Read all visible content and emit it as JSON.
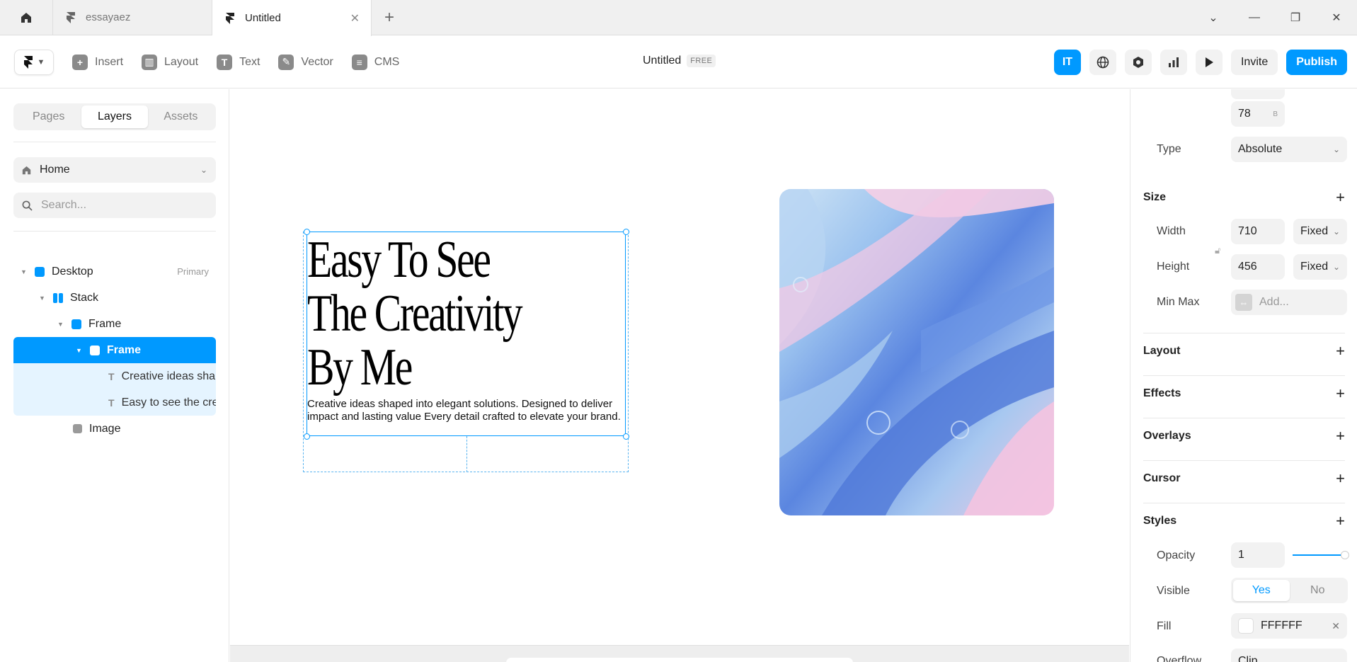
{
  "tabs": [
    {
      "label": "essayaez"
    },
    {
      "label": "Untitled"
    }
  ],
  "toolbar": {
    "tools": [
      {
        "label": "Insert",
        "icon": "plus-square-icon"
      },
      {
        "label": "Layout",
        "icon": "layout-icon"
      },
      {
        "label": "Text",
        "icon": "text-icon"
      },
      {
        "label": "Vector",
        "icon": "pen-icon"
      },
      {
        "label": "CMS",
        "icon": "database-icon"
      }
    ],
    "doc_title": "Untitled",
    "plan_badge": "FREE",
    "avatar_initials": "IT",
    "invite_label": "Invite",
    "publish_label": "Publish"
  },
  "left_panel": {
    "segments": [
      "Pages",
      "Layers",
      "Assets"
    ],
    "active_segment": "Layers",
    "page": "Home",
    "search_placeholder": "Search...",
    "layers": [
      {
        "label": "Desktop",
        "tag": "Primary"
      },
      {
        "label": "Stack"
      },
      {
        "label": "Frame"
      },
      {
        "label": "Frame"
      },
      {
        "label": "Creative ideas shaped into elegant solutions"
      },
      {
        "label": "Easy to see the creativity by me"
      },
      {
        "label": "Image"
      }
    ]
  },
  "canvas": {
    "headline_lines": [
      "Easy To See",
      "The Creativity",
      "By Me"
    ],
    "body": "Creative ideas shaped into elegant solutions. Designed to deliver impact and lasting value Every detail crafted to elevate your brand."
  },
  "right_panel": {
    "bottom_value": "78",
    "bottom_suffix": "B",
    "type_label": "Type",
    "type_value": "Absolute",
    "size_section": "Size",
    "width_label": "Width",
    "width_value": "710",
    "width_mode": "Fixed",
    "height_label": "Height",
    "height_value": "456",
    "height_mode": "Fixed",
    "minmax_label": "Min Max",
    "minmax_placeholder": "Add...",
    "sections": [
      "Layout",
      "Effects",
      "Overlays",
      "Cursor",
      "Styles"
    ],
    "opacity_label": "Opacity",
    "opacity_value": "1",
    "visible_label": "Visible",
    "visible_yes": "Yes",
    "visible_no": "No",
    "fill_label": "Fill",
    "fill_value": "FFFFFF",
    "overflow_label": "Overflow",
    "overflow_value": "Clip"
  },
  "colors": {
    "accent": "#0099ff",
    "selection_tint": "#e5f4ff"
  }
}
